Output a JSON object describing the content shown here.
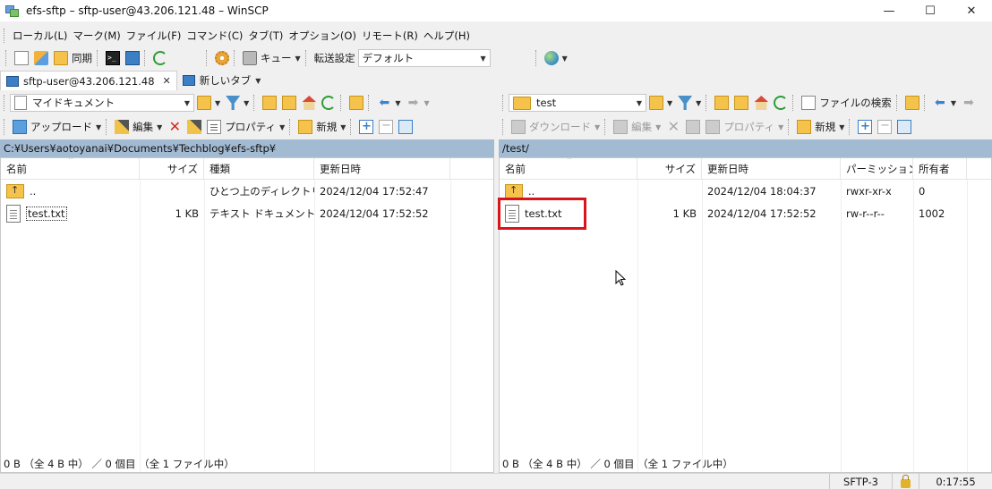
{
  "window": {
    "title": "efs-sftp – sftp-user@43.206.121.48 – WinSCP",
    "minimize": "—",
    "maximize": "☐",
    "close": "✕"
  },
  "menu": [
    "ローカル(L)",
    "マーク(M)",
    "ファイル(F)",
    "コマンド(C)",
    "タブ(T)",
    "オプション(O)",
    "リモート(R)",
    "ヘルプ(H)"
  ],
  "toolbar": {
    "sync": "同期",
    "queue": "キュー",
    "transfer_label": "転送設定",
    "transfer_value": "デフォルト"
  },
  "tabs": [
    {
      "label": "sftp-user@43.206.121.48",
      "close": "✕"
    },
    {
      "label": "新しいタブ"
    }
  ],
  "left": {
    "location": "マイドキュメント",
    "path": "C:¥Users¥aotoyanai¥Documents¥Techblog¥efs-sftp¥",
    "actions": {
      "upload": "アップロード",
      "edit": "編集",
      "properties": "プロパティ",
      "new": "新規"
    },
    "columns": [
      "名前",
      "サイズ",
      "種類",
      "更新日時"
    ],
    "rows": [
      {
        "name": "..",
        "size": "",
        "type": "ひとつ上のディレクトリ",
        "modified": "2024/12/04 17:52:47",
        "icon": "parent-folder-icon"
      },
      {
        "name": "test.txt",
        "size": "1 KB",
        "type": "テキスト ドキュメント",
        "modified": "2024/12/04 17:52:52",
        "icon": "text-file-icon"
      }
    ],
    "status": "0 B （全 4 B 中） ／ 0 個目 （全 1 ファイル中）"
  },
  "right": {
    "location": "test",
    "path": "/test/",
    "find_files": "ファイルの検索",
    "actions": {
      "download": "ダウンロード",
      "edit": "編集",
      "properties": "プロパティ",
      "new": "新規"
    },
    "columns": [
      "名前",
      "サイズ",
      "更新日時",
      "パーミッション",
      "所有者"
    ],
    "rows": [
      {
        "name": "..",
        "size": "",
        "modified": "2024/12/04 18:04:37",
        "permissions": "rwxr-xr-x",
        "owner": "0",
        "icon": "parent-folder-icon"
      },
      {
        "name": "test.txt",
        "size": "1 KB",
        "modified": "2024/12/04 17:52:52",
        "permissions": "rw-r--r--",
        "owner": "1002",
        "icon": "text-file-icon"
      }
    ],
    "status": "0 B （全 4 B 中） ／ 0 個目 （全 1 ファイル中）"
  },
  "statusbar": {
    "protocol": "SFTP-3",
    "elapsed": "0:17:55"
  },
  "colors": {
    "path_bar": "#a2bad2",
    "highlight": "#d9141c"
  }
}
